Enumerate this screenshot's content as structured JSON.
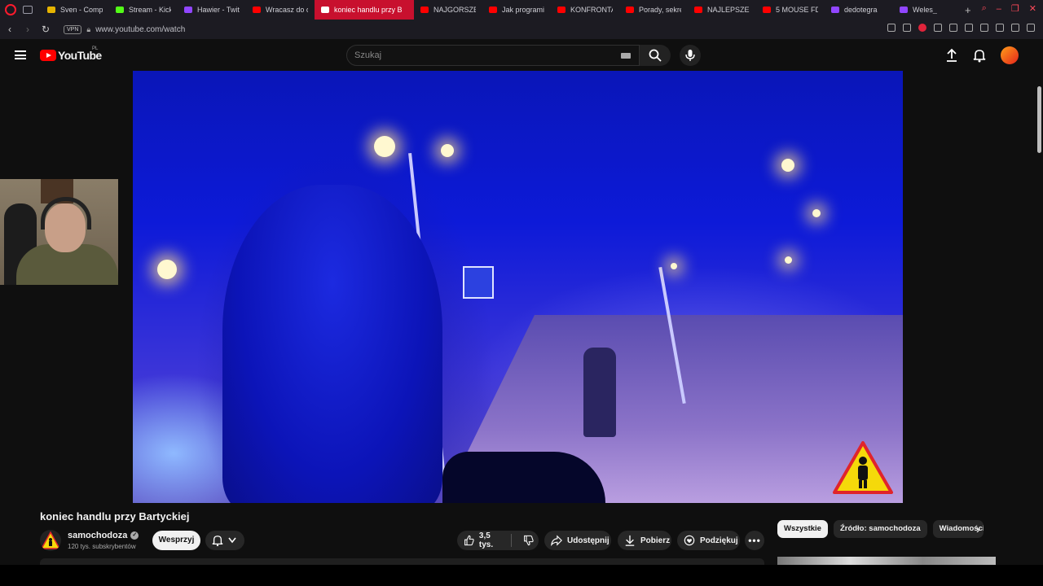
{
  "browser": {
    "tabs": [
      {
        "label": "Sven - Compl",
        "fav_color": "#e6b400"
      },
      {
        "label": "Stream - Kick",
        "fav_color": "#53fc18"
      },
      {
        "label": "Hawier - Twit",
        "fav_color": "#9146ff"
      },
      {
        "label": "Wracasz do c",
        "fav_color": "#ff0000"
      },
      {
        "label": "koniec handlu przy B",
        "fav_color": "#ffffff",
        "active": true
      },
      {
        "label": "NAJGORSZE",
        "fav_color": "#ff0000"
      },
      {
        "label": "Jak programi",
        "fav_color": "#ff0000"
      },
      {
        "label": "KONFRONTA",
        "fav_color": "#ff0000"
      },
      {
        "label": "Porady, sekre",
        "fav_color": "#ff0000"
      },
      {
        "label": "NAJLEPSZE",
        "fav_color": "#ff0000"
      },
      {
        "label": "5 MOUSE FD",
        "fav_color": "#ff0000"
      },
      {
        "label": "dedotegra",
        "fav_color": "#9146ff"
      },
      {
        "label": "Weles_",
        "fav_color": "#9146ff"
      }
    ],
    "vpn_label": "VPN",
    "url": "www.youtube.com/watch"
  },
  "youtube": {
    "logo_text": "YouTube",
    "country_code": "PL",
    "search_placeholder": "Szukaj"
  },
  "video": {
    "title": "koniec handlu przy Bartyckiej",
    "channel": "samochodoza",
    "subscribers": "120 tys. subskrybentów",
    "support_label": "Wesprzyj",
    "likes": "3,5 tys.",
    "share_label": "Udostępnij",
    "download_label": "Pobierz",
    "thanks_label": "Podziękuj"
  },
  "chips": [
    "Wszystkie",
    "Źródło: samochodoza",
    "Wiadomości"
  ],
  "colors": {
    "accent": "#ff0000",
    "opera_red": "#c8102e",
    "background": "#0f0f0f"
  }
}
